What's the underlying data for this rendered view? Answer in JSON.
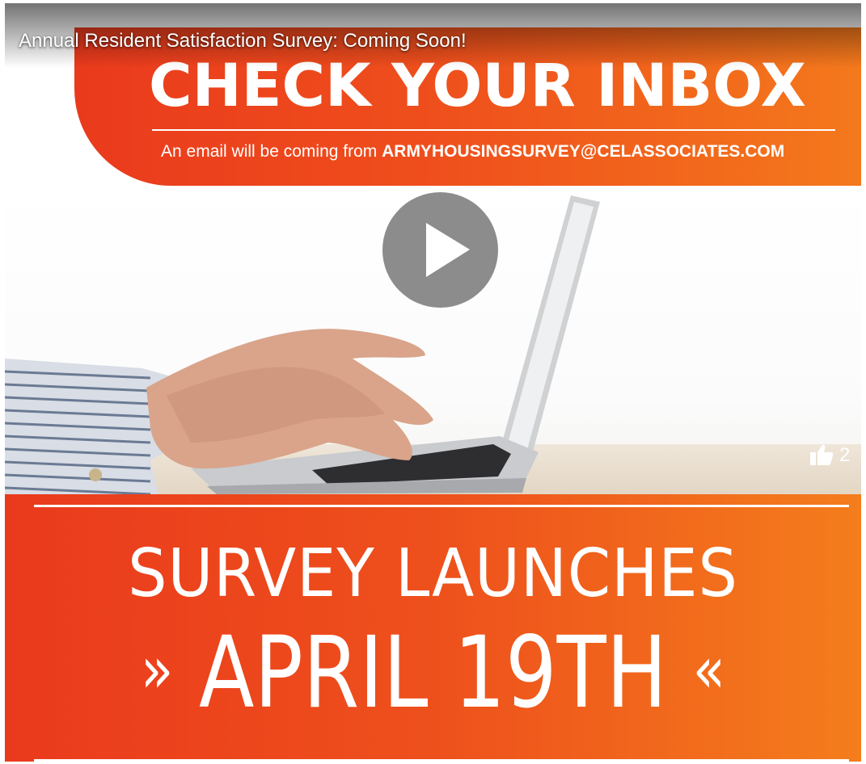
{
  "video": {
    "title": "Annual Resident Satisfaction Survey: Coming Soon!",
    "like_count": "2"
  },
  "banner": {
    "headline": "CHECK YOUR INBOX",
    "sub_prefix": "An email will be coming from",
    "email": "ARMYHOUSINGSURVEY@CELASSOCIATES.COM"
  },
  "launch": {
    "line1": "SURVEY LAUNCHES",
    "left_mark": "»",
    "date": "APRIL 19TH",
    "right_mark": "«"
  },
  "colors": {
    "orange_start": "#ea3a1d",
    "orange_end": "#f47d1c",
    "play_button": "#787878"
  },
  "icons": {
    "play": "play-icon",
    "like": "thumbs-up-icon"
  }
}
